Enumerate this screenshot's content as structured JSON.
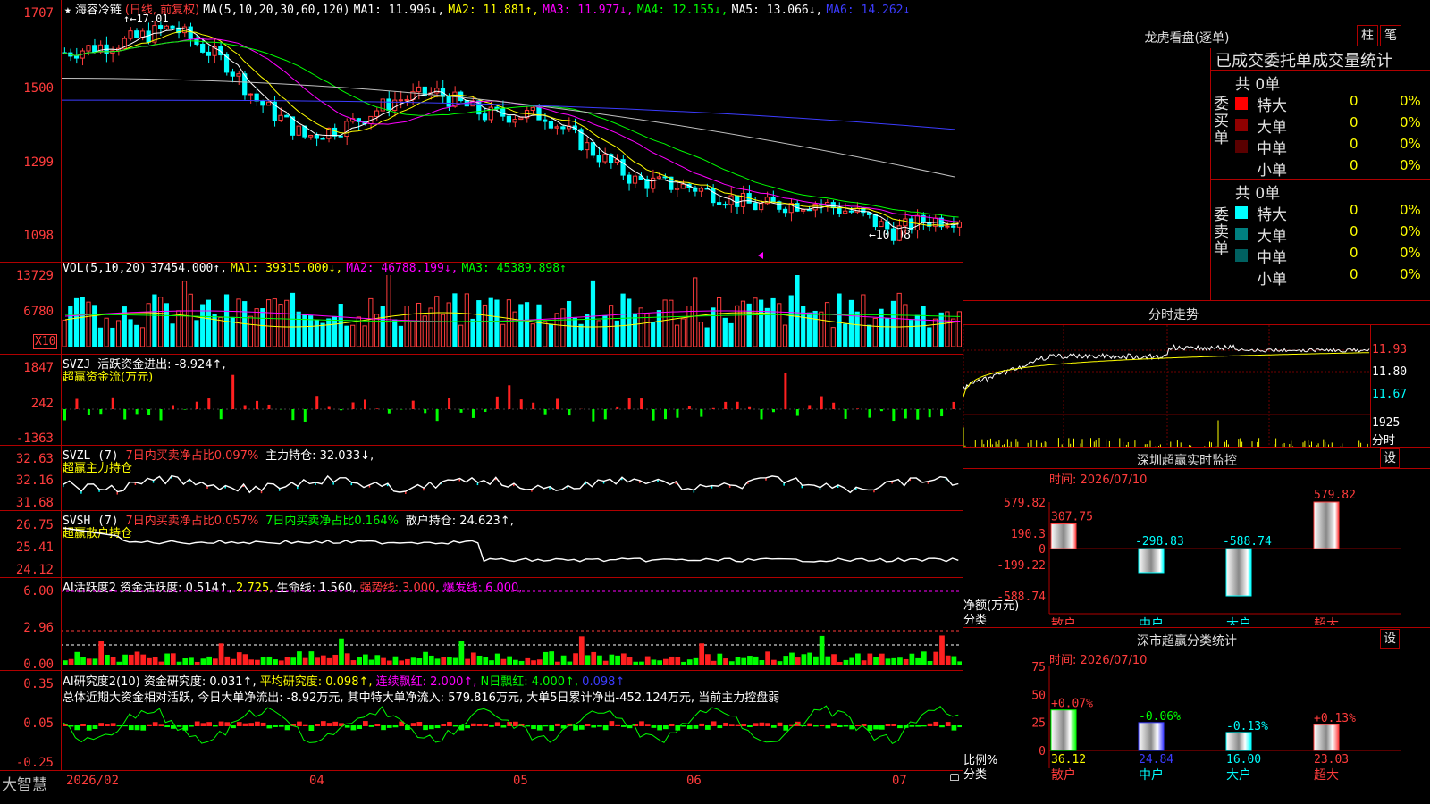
{
  "header": {
    "star": "★",
    "stock_name": "海容冷链",
    "mode": "(日线, 前复权)",
    "ma_label": "MA(5,10,20,30,60,120)",
    "ma1": "MA1: 11.996↓,",
    "ma2": "MA2: 11.881↑,",
    "ma3": "MA3: 11.977↓,",
    "ma4": "MA4: 12.155↓,",
    "ma5": "MA5: 13.066↓,",
    "ma6": "MA6: 14.262↓"
  },
  "price_axis": [
    "1707",
    "1500",
    "1299",
    "1098"
  ],
  "price_notes": {
    "high": "17.01",
    "low": "←10.98"
  },
  "vol": {
    "label": "VOL(5,10,20)",
    "value": "37454.000↑,",
    "ma1": "MA1: 39315.000↓,",
    "ma2": "MA2: 46788.199↓,",
    "ma3": "MA3: 45389.898↑",
    "axis": [
      "13729",
      "6780"
    ],
    "unit": "X10"
  },
  "svzj": {
    "label": "SVZJ",
    "text1": "活跃资金进出: -8.924↑,",
    "text2": "超赢资金流(万元)",
    "axis": [
      "1847",
      "242",
      "-1363"
    ]
  },
  "svzl": {
    "label": "SVZL (7)",
    "text1": "7日内买卖净占比0.097%",
    "text2": "主力持仓: 32.033↓,",
    "text3": "超赢主力持仓",
    "axis": [
      "32.63",
      "32.16",
      "31.68"
    ]
  },
  "svsh": {
    "label": "SVSH (7)",
    "text1": "7日内买卖净占比0.057%",
    "text2": "7日内买卖净占比0.164%",
    "text3": "散户持仓: 24.623↑,",
    "text4": "超赢散户持仓",
    "axis": [
      "26.75",
      "25.41",
      "24.12"
    ]
  },
  "ai_active": {
    "label": "AI活跃度2",
    "text1": "资金活跃度: 0.514↑,",
    "text2": "2.725,",
    "text3": "生命线: 1.560,",
    "text4": "强势线: 3.000,",
    "text5": "爆发线: 6.000,",
    "axis": [
      "6.00",
      "2.96",
      "0.00"
    ]
  },
  "ai_research": {
    "label": "AI研究度2(10)",
    "text1": "资金研究度: 0.031↑,",
    "text2": "平均研究度: 0.098↑,",
    "text3": "连续飘红: 2.000↑,",
    "text4": "N日飘红: 4.000↑,",
    "text5": "0.098↑",
    "summary": "总体近期大资金相对活跃, 今日大单净流出: -8.92万元, 其中特大单净流入: 579.816万元, 大单5日累计净出-452.124万元, 当前主力控盘弱",
    "axis": [
      "0.35",
      "0.05",
      "-0.25"
    ]
  },
  "time_axis": [
    "2026/02",
    "04",
    "05",
    "06",
    "07"
  ],
  "brand": "大智慧",
  "dragon": {
    "title": "龙虎看盘(逐单)",
    "btn1": "柱",
    "btn2": "笔",
    "subtitle": "已成交委托单成交量统计",
    "buy_label": "委买单",
    "sell_label": "委卖单",
    "buy_total": "共 0单",
    "sell_total": "共 0单",
    "buy_rows": [
      {
        "name": "特大",
        "count": "0",
        "pct": "0%",
        "color": "#ff0000"
      },
      {
        "name": "大单",
        "count": "0",
        "pct": "0%",
        "color": "#900000"
      },
      {
        "name": "中单",
        "count": "0",
        "pct": "0%",
        "color": "#5a0000"
      },
      {
        "name": "小单",
        "count": "0",
        "pct": "0%",
        "color": "#000000"
      }
    ],
    "sell_rows": [
      {
        "name": "特大",
        "count": "0",
        "pct": "0%",
        "color": "#00ffff"
      },
      {
        "name": "大单",
        "count": "0",
        "pct": "0%",
        "color": "#008080"
      },
      {
        "name": "中单",
        "count": "0",
        "pct": "0%",
        "color": "#006060"
      },
      {
        "name": "小单",
        "count": "0",
        "pct": "0%",
        "color": "#000000"
      }
    ]
  },
  "intraday": {
    "title": "分时走势",
    "axis": [
      "11.93",
      "11.80",
      "11.67"
    ],
    "vol_axis": "1925",
    "vol_unit": "分时"
  },
  "sz_monitor": {
    "title": "深圳超赢实时监控",
    "settings": "设",
    "time": "时间: 2026/07/10",
    "axis": [
      "579.82",
      "190.3",
      "0",
      "-199.22",
      "-588.74"
    ],
    "ylabel": "净额(万元)",
    "xlabel": "分类",
    "bars": [
      {
        "name": "散户",
        "value": 307.75,
        "label": "307.75"
      },
      {
        "name": "中户",
        "value": -298.83,
        "label": "-298.83"
      },
      {
        "name": "大户",
        "value": -588.74,
        "label": "-588.74"
      },
      {
        "name": "超大",
        "value": 579.82,
        "label": "579.82"
      }
    ]
  },
  "sz_classify": {
    "title": "深市超赢分类统计",
    "settings": "设",
    "time": "时间: 2026/07/10",
    "axis": [
      "75",
      "50",
      "25",
      "0"
    ],
    "ylabel": "比例%",
    "xlabel": "分类",
    "bars": [
      {
        "name": "散户",
        "value": 36.12,
        "label": "36.12",
        "change": "+0.07%"
      },
      {
        "name": "中户",
        "value": 24.84,
        "label": "24.84",
        "change": "-0.06%"
      },
      {
        "name": "大户",
        "value": 16.0,
        "label": "16.00",
        "change": "-0.13%"
      },
      {
        "name": "超大",
        "value": 23.03,
        "label": "23.03",
        "change": "+0.13%"
      }
    ]
  }
}
